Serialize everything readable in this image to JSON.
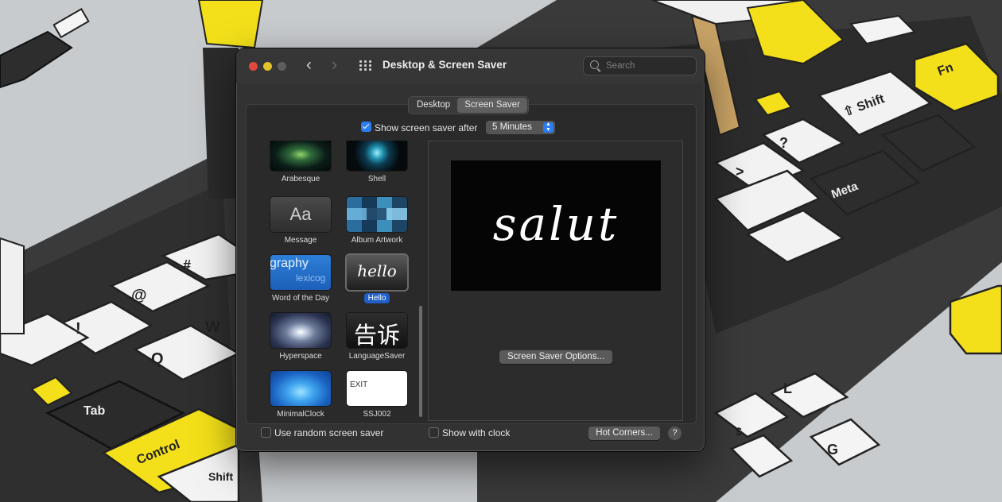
{
  "window": {
    "title": "Desktop & Screen Saver",
    "search_placeholder": "Search"
  },
  "tabs": [
    {
      "label": "Desktop",
      "selected": false
    },
    {
      "label": "Screen Saver",
      "selected": true
    }
  ],
  "show_after": {
    "label": "Show screen saver after",
    "checked": true,
    "value": "5 Minutes"
  },
  "savers": [
    {
      "name": "Arabesque",
      "selected": false
    },
    {
      "name": "Shell",
      "selected": false
    },
    {
      "name": "Message",
      "selected": false,
      "thumb_text": "Aa"
    },
    {
      "name": "Album Artwork",
      "selected": false
    },
    {
      "name": "Word of the Day",
      "selected": false,
      "thumb_text": "graphy",
      "thumb_sub": "lexicog"
    },
    {
      "name": "Hello",
      "selected": true,
      "thumb_text": "hello"
    },
    {
      "name": "Hyperspace",
      "selected": false
    },
    {
      "name": "LanguageSaver",
      "selected": false,
      "thumb_text": "告诉"
    },
    {
      "name": "MinimalClock",
      "selected": false
    },
    {
      "name": "SSJ002",
      "selected": false,
      "thumb_text": "EXIT"
    }
  ],
  "preview_text": "salut",
  "options_button": "Screen Saver Options...",
  "random_saver": {
    "label": "Use random screen saver",
    "checked": false
  },
  "show_clock": {
    "label": "Show with clock",
    "checked": false
  },
  "hot_corners_button": "Hot Corners...",
  "help_button": "?",
  "background_keys": [
    "Fn",
    "Shift",
    "Meta",
    "Control",
    "Tab",
    "Shift"
  ],
  "colors": {
    "accent": "#2a7cf1",
    "selection": "#1f5fc7",
    "key_yellow": "#f3e01a"
  }
}
